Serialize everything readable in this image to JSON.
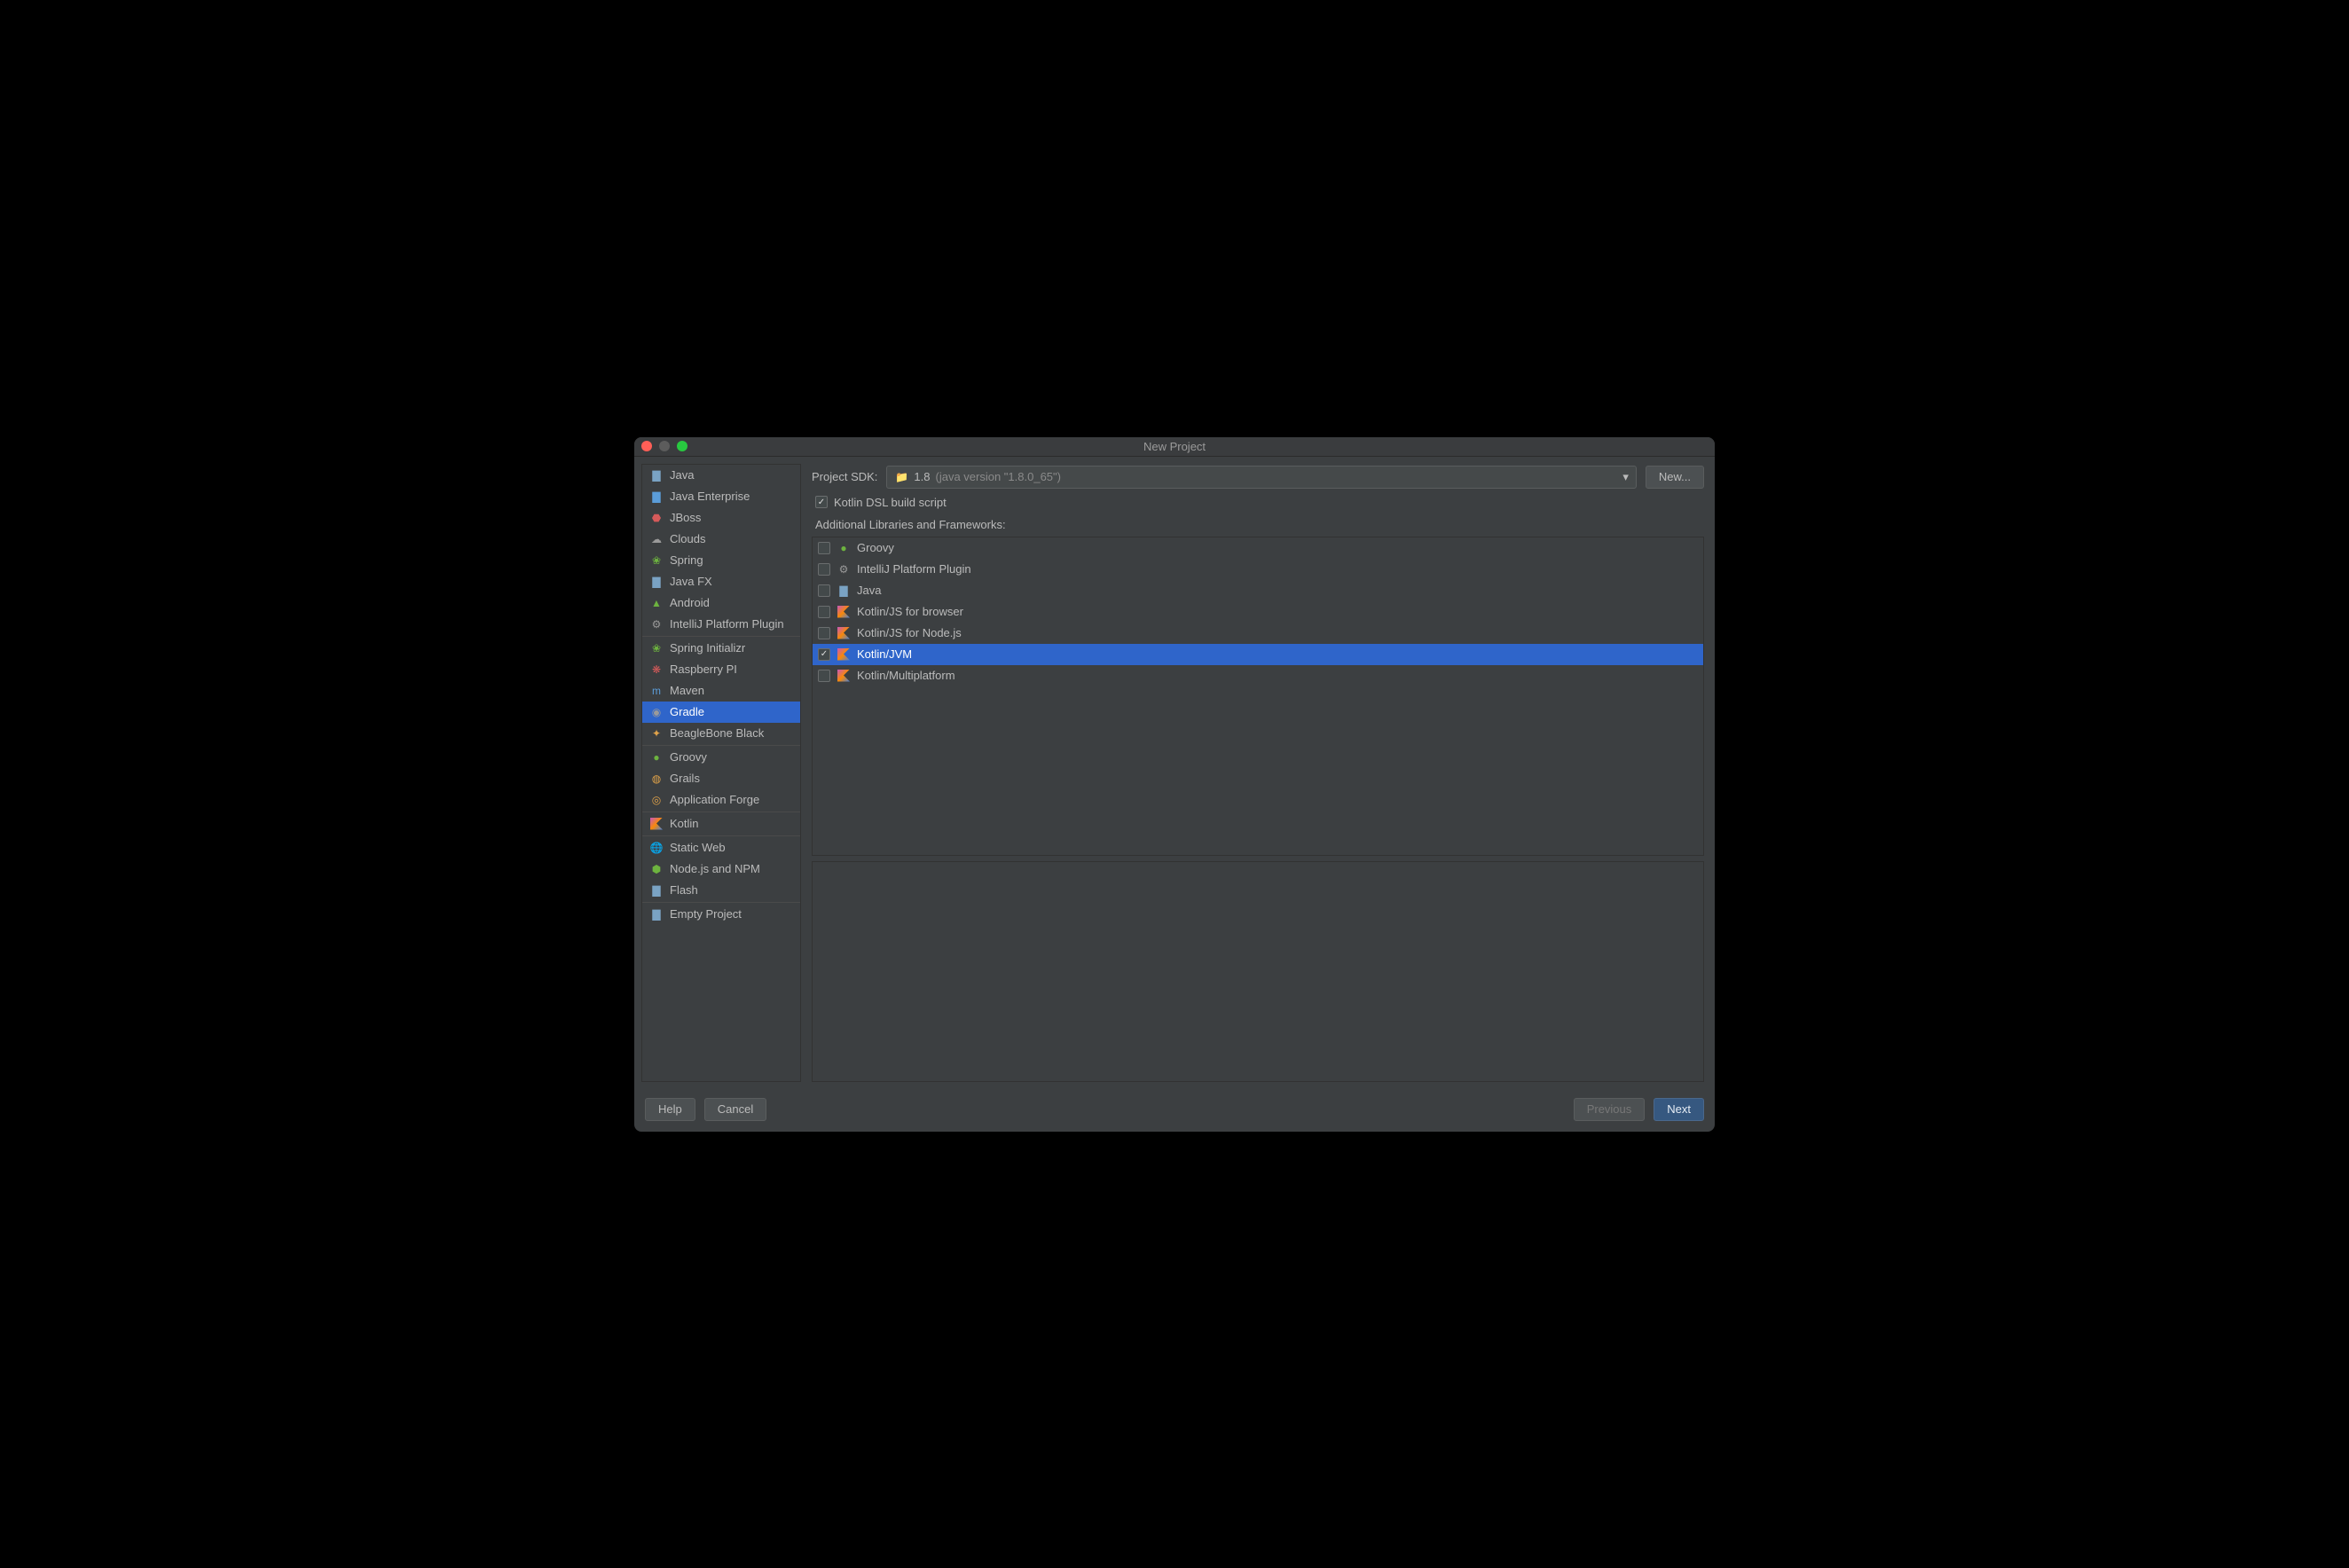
{
  "window": {
    "title": "New Project"
  },
  "sidebar": {
    "groups": [
      [
        {
          "label": "Java",
          "icon": "folder-icon",
          "cls": "ic-folder"
        },
        {
          "label": "Java Enterprise",
          "icon": "folder-icon",
          "cls": "ic-blue"
        },
        {
          "label": "JBoss",
          "icon": "jboss-icon",
          "cls": "ic-red"
        },
        {
          "label": "Clouds",
          "icon": "cloud-icon",
          "cls": "ic-gray"
        },
        {
          "label": "Spring",
          "icon": "spring-icon",
          "cls": "ic-green"
        },
        {
          "label": "Java FX",
          "icon": "folder-icon",
          "cls": "ic-folder"
        },
        {
          "label": "Android",
          "icon": "android-icon",
          "cls": "ic-green"
        },
        {
          "label": "IntelliJ Platform Plugin",
          "icon": "plugin-icon",
          "cls": "ic-gray"
        }
      ],
      [
        {
          "label": "Spring Initializr",
          "icon": "spring-icon",
          "cls": "ic-green"
        },
        {
          "label": "Raspberry PI",
          "icon": "raspberry-icon",
          "cls": "ic-red"
        },
        {
          "label": "Maven",
          "icon": "maven-icon",
          "cls": "ic-blue"
        },
        {
          "label": "Gradle",
          "icon": "gradle-icon",
          "cls": "ic-gray",
          "selected": true
        },
        {
          "label": "BeagleBone Black",
          "icon": "beagle-icon",
          "cls": "ic-orange"
        }
      ],
      [
        {
          "label": "Groovy",
          "icon": "groovy-icon",
          "cls": "ic-green"
        },
        {
          "label": "Grails",
          "icon": "grails-icon",
          "cls": "ic-orange"
        },
        {
          "label": "Application Forge",
          "icon": "forge-icon",
          "cls": "ic-orange"
        }
      ],
      [
        {
          "label": "Kotlin",
          "icon": "kotlin-icon",
          "cls": "kotlin"
        }
      ],
      [
        {
          "label": "Static Web",
          "icon": "globe-icon",
          "cls": "ic-gray"
        },
        {
          "label": "Node.js and NPM",
          "icon": "node-icon",
          "cls": "ic-green"
        },
        {
          "label": "Flash",
          "icon": "folder-icon",
          "cls": "ic-folder"
        }
      ],
      [
        {
          "label": "Empty Project",
          "icon": "folder-icon",
          "cls": "ic-folder"
        }
      ]
    ]
  },
  "sdk": {
    "label": "Project SDK:",
    "value": "1.8",
    "detail": "(java version \"1.8.0_65\")",
    "new_button": "New..."
  },
  "dsl_checkbox": {
    "checked": true,
    "label": "Kotlin DSL build script"
  },
  "frameworks": {
    "label": "Additional Libraries and Frameworks:",
    "items": [
      {
        "label": "Groovy",
        "icon": "groovy-icon",
        "cls": "ic-green",
        "checked": false
      },
      {
        "label": "IntelliJ Platform Plugin",
        "icon": "plugin-icon",
        "cls": "ic-gray",
        "checked": false
      },
      {
        "label": "Java",
        "icon": "folder-icon",
        "cls": "ic-folder",
        "checked": false
      },
      {
        "label": "Kotlin/JS for browser",
        "icon": "kotlin-icon",
        "cls": "kotlin",
        "checked": false
      },
      {
        "label": "Kotlin/JS for Node.js",
        "icon": "kotlin-icon",
        "cls": "kotlin",
        "checked": false
      },
      {
        "label": "Kotlin/JVM",
        "icon": "kotlin-icon",
        "cls": "kotlin",
        "checked": true,
        "selected": true
      },
      {
        "label": "Kotlin/Multiplatform",
        "icon": "kotlin-icon",
        "cls": "kotlin",
        "checked": false
      }
    ]
  },
  "footer": {
    "help": "Help",
    "cancel": "Cancel",
    "previous": "Previous",
    "next": "Next"
  }
}
